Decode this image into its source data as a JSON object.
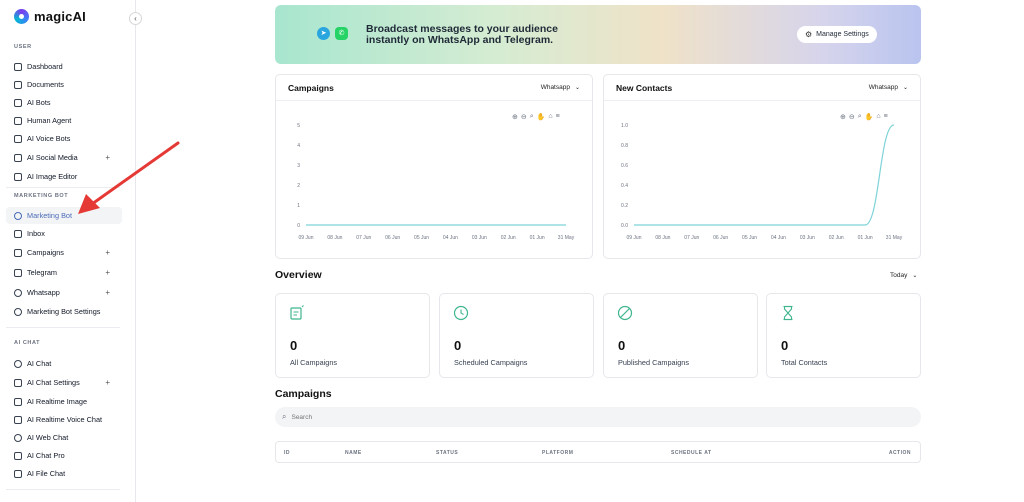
{
  "sidebar": {
    "brand": "magicAI",
    "collapse_icon": "‹",
    "sections": {
      "user": "USER",
      "marketing_bot": "MARKETING BOT",
      "ai_chat": "AI CHAT"
    },
    "items": [
      {
        "label": "Dashboard"
      },
      {
        "label": "Documents"
      },
      {
        "label": "AI Bots"
      },
      {
        "label": "Human Agent"
      },
      {
        "label": "AI Voice Bots"
      },
      {
        "label": "AI Social Media",
        "plus": "+"
      },
      {
        "label": "AI Image Editor"
      },
      {
        "label": "Marketing Bot"
      },
      {
        "label": "Inbox"
      },
      {
        "label": "Campaigns",
        "plus": "+"
      },
      {
        "label": "Telegram",
        "plus": "+"
      },
      {
        "label": "Whatsapp",
        "plus": "+"
      },
      {
        "label": "Marketing Bot Settings"
      },
      {
        "label": "AI Chat"
      },
      {
        "label": "AI Chat Settings",
        "plus": "+"
      },
      {
        "label": "AI Realtime Image"
      },
      {
        "label": "AI Realtime Voice Chat"
      },
      {
        "label": "AI Web Chat"
      },
      {
        "label": "AI Chat Pro"
      },
      {
        "label": "AI File Chat"
      }
    ]
  },
  "banner": {
    "text": "Broadcast messages to your audience instantly on WhatsApp and Telegram.",
    "manage_label": "Manage Settings"
  },
  "campaigns_chart": {
    "title": "Campaigns",
    "select": "Whatsapp"
  },
  "contacts_chart": {
    "title": "New Contacts",
    "select": "Whatsapp"
  },
  "chart_data": [
    {
      "type": "line",
      "title": "Campaigns",
      "x": [
        "09 Jun",
        "08 Jun",
        "07 Jun",
        "06 Jun",
        "05 Jun",
        "04 Jun",
        "03 Jun",
        "02 Jun",
        "01 Jun",
        "31 May"
      ],
      "y_ticks": [
        "5",
        "4",
        "3",
        "2",
        "1",
        "0"
      ],
      "series": [
        {
          "values": [
            0,
            0,
            0,
            0,
            0,
            0,
            0,
            0,
            0,
            0
          ]
        }
      ],
      "ylim": [
        0,
        5
      ],
      "color": "#7ed3d9"
    },
    {
      "type": "line",
      "title": "New Contacts",
      "x": [
        "09 Jun",
        "08 Jun",
        "07 Jun",
        "06 Jun",
        "05 Jun",
        "04 Jun",
        "03 Jun",
        "02 Jun",
        "01 Jun",
        "31 May"
      ],
      "y_ticks": [
        "1.0",
        "0.8",
        "0.6",
        "0.4",
        "0.2",
        "0.0"
      ],
      "series": [
        {
          "values": [
            0,
            0,
            0,
            0,
            0,
            0,
            0,
            0,
            0,
            1
          ]
        }
      ],
      "ylim": [
        0,
        1
      ],
      "color": "#7ed3d9"
    }
  ],
  "overview": {
    "title": "Overview",
    "range": "Today",
    "stats": [
      {
        "value": "0",
        "label": "All Campaigns",
        "icon": "checklist-icon"
      },
      {
        "value": "0",
        "label": "Scheduled Campaigns",
        "icon": "clock-icon"
      },
      {
        "value": "0",
        "label": "Published Campaigns",
        "icon": "slash-circle-icon"
      },
      {
        "value": "0",
        "label": "Total Contacts",
        "icon": "hourglass-icon"
      }
    ]
  },
  "campaigns": {
    "title": "Campaigns",
    "search_placeholder": "Search",
    "columns": [
      "ID",
      "NAME",
      "STATUS",
      "PLATFORM",
      "SCHEDULE AT",
      "ACTION"
    ]
  },
  "colors": {
    "accent": "#4b6bb7",
    "line": "#7ed3d9",
    "stat_icon": "#3fb68b"
  }
}
